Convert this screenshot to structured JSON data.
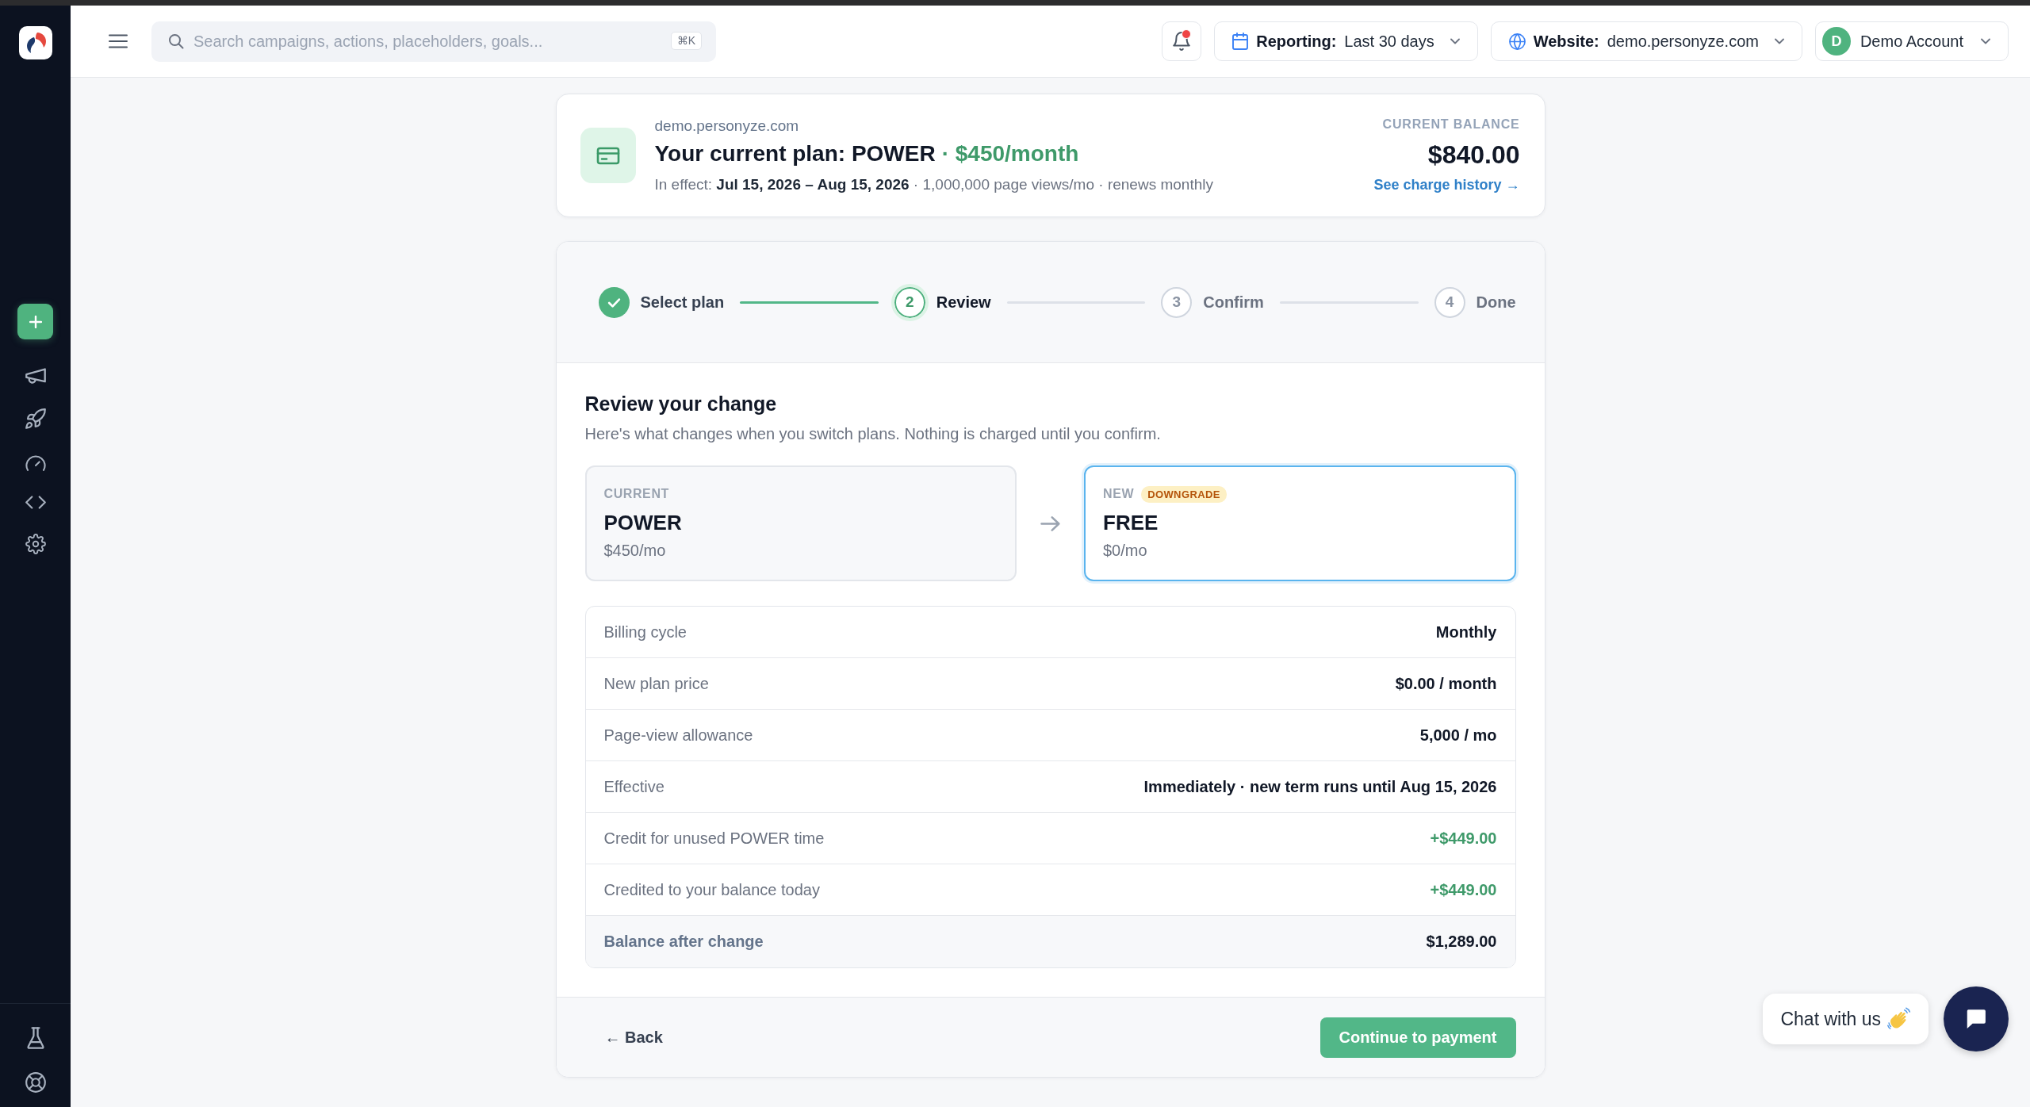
{
  "top_bar": {
    "search": {
      "placeholder": "Search campaigns, actions, placeholders, goals...",
      "shortcut": "⌘K"
    },
    "notifications": {
      "unread": true
    },
    "reporting": {
      "label": "Reporting:",
      "value": "Last 30 days"
    },
    "website": {
      "label": "Website:",
      "value": "demo.personyze.com"
    },
    "account": {
      "initial": "D",
      "name": "Demo Account"
    }
  },
  "plan": {
    "site": "demo.personyze.com",
    "title": "Your current plan: POWER",
    "price": "· $450/month",
    "details": "In effect: **Jul 15, 2026 – Aug 15, 2026** · 1,000,000 page views/mo · renews monthly",
    "balance_label": "CURRENT BALANCE",
    "balance": "$840.00",
    "history_link": "See charge history →"
  },
  "stepper": {
    "steps": [
      {
        "label": "Select plan",
        "completed": true,
        "selected": false
      },
      {
        "number": "2",
        "label": "Review",
        "completed": false,
        "selected": true
      },
      {
        "number": "3",
        "label": "Confirm",
        "completed": false,
        "selected": false
      },
      {
        "number": "4",
        "label": "Done",
        "completed": false,
        "selected": false
      }
    ]
  },
  "review": {
    "title": "Review your change",
    "subtitle": "Here's what changes when you switch plans. Nothing is charged until you confirm.",
    "plans": [
      {
        "label": "CURRENT",
        "name": "POWER",
        "price": "$450/mo",
        "selected": false
      },
      {
        "label": "NEW",
        "badge": "DOWNGRADE",
        "name": "FREE",
        "price": "$0/mo",
        "selected": true
      }
    ],
    "summary": [
      {
        "kind": "plain",
        "label": "Billing cycle",
        "value": "Monthly"
      },
      {
        "kind": "plain",
        "label": "New plan price",
        "value": "$0.00 / month"
      },
      {
        "kind": "plain",
        "label": "Page-view allowance",
        "value": "5,000 / mo"
      },
      {
        "kind": "plain",
        "label": "Effective",
        "value": "Immediately · new term runs until Aug 15, 2026"
      },
      {
        "kind": "credit",
        "label": "Credit for unused POWER time",
        "value": "+$449.00"
      },
      {
        "kind": "credit",
        "label": "Credited to your balance today",
        "value": "+$449.00"
      },
      {
        "kind": "total",
        "label": "Balance after change",
        "value": "$1,289.00"
      }
    ]
  },
  "footer": {
    "back": "← Back",
    "continue": "Continue to payment"
  },
  "chat": {
    "label": "Chat with us"
  }
}
